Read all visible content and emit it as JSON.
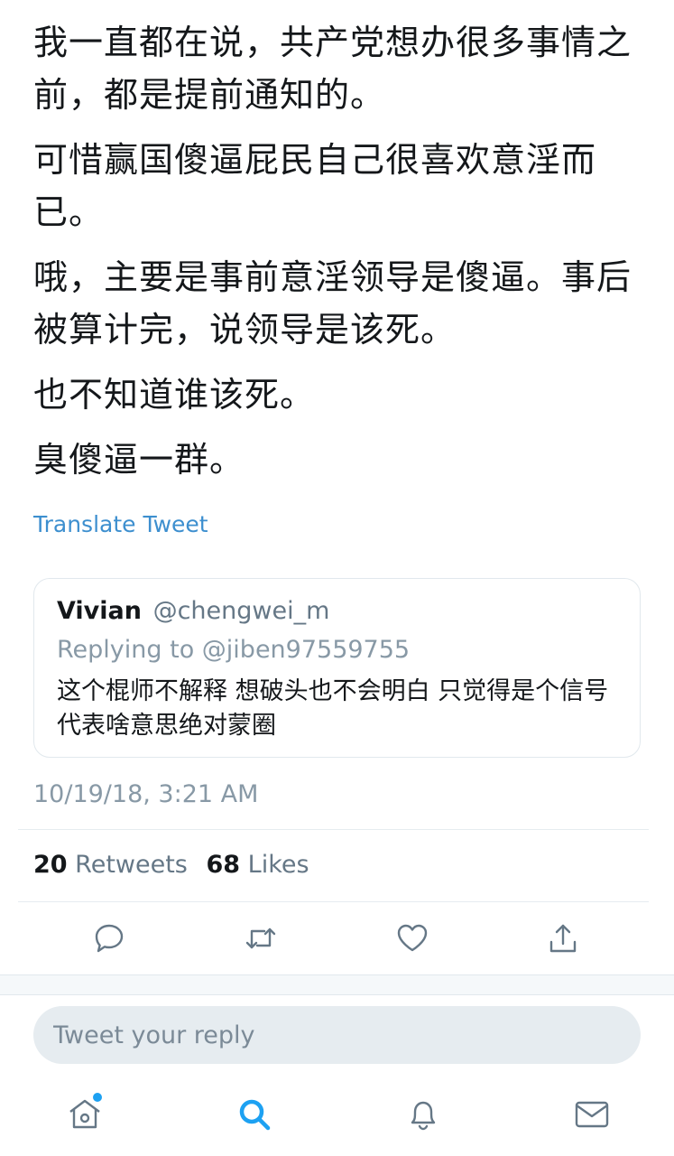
{
  "tweet": {
    "paragraphs": [
      "我一直都在说，共产党想办很多事情之前，都是提前通知的。",
      "可惜赢国傻逼屁民自己很喜欢意淫而已。",
      "哦，主要是事前意淫领导是傻逼。事后被算计完，说领导是该死。",
      "也不知道谁该死。",
      "臭傻逼一群。"
    ],
    "translate_link": "Translate Tweet",
    "timestamp": "10/19/18, 3:21 AM"
  },
  "quoted_tweet": {
    "name": "Vivian",
    "handle": "@chengwei_m",
    "replying_to": "Replying to @jiben97559755",
    "text": "这个棍师不解释 想破头也不会明白 只觉得是个信号 代表啥意思绝对蒙圈"
  },
  "stats": {
    "retweets_count": "20",
    "retweets_label": "Retweets",
    "likes_count": "68",
    "likes_label": "Likes"
  },
  "actions": [
    "reply-icon",
    "retweet-icon",
    "like-icon",
    "share-icon"
  ],
  "reply": {
    "placeholder": "Tweet your reply"
  },
  "tabbar": {
    "items": [
      "home-icon",
      "search-icon",
      "notifications-icon",
      "messages-icon"
    ],
    "active": "search-icon"
  },
  "colors": {
    "accent": "#1da1f2",
    "link": "#3d8fcf",
    "muted": "#8899a6"
  }
}
